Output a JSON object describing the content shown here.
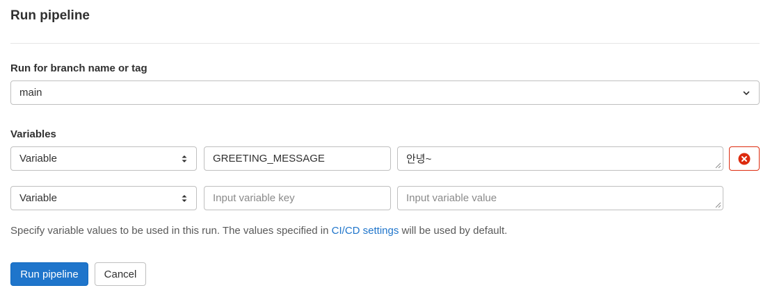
{
  "page": {
    "title": "Run pipeline"
  },
  "branch": {
    "label": "Run for branch name or tag",
    "selected": "main"
  },
  "variables": {
    "label": "Variables",
    "rows": [
      {
        "type": "Variable",
        "key": "GREETING_MESSAGE",
        "value": "안녕~"
      },
      {
        "type": "Variable",
        "key_placeholder": "Input variable key",
        "value_placeholder": "Input variable value"
      }
    ]
  },
  "help": {
    "prefix": "Specify variable values to be used in this run. The values specified in",
    "link": "CI/CD settings",
    "suffix": "will be used by default."
  },
  "actions": {
    "run_label": "Run pipeline",
    "cancel_label": "Cancel"
  },
  "colors": {
    "primary": "#1f75cb",
    "danger": "#dd2b0e",
    "link": "#1f75cb"
  },
  "icons": {
    "branch_dropdown": "chevron-down-icon",
    "type_select": "sort-updown-icon",
    "remove": "remove-circle-icon"
  }
}
